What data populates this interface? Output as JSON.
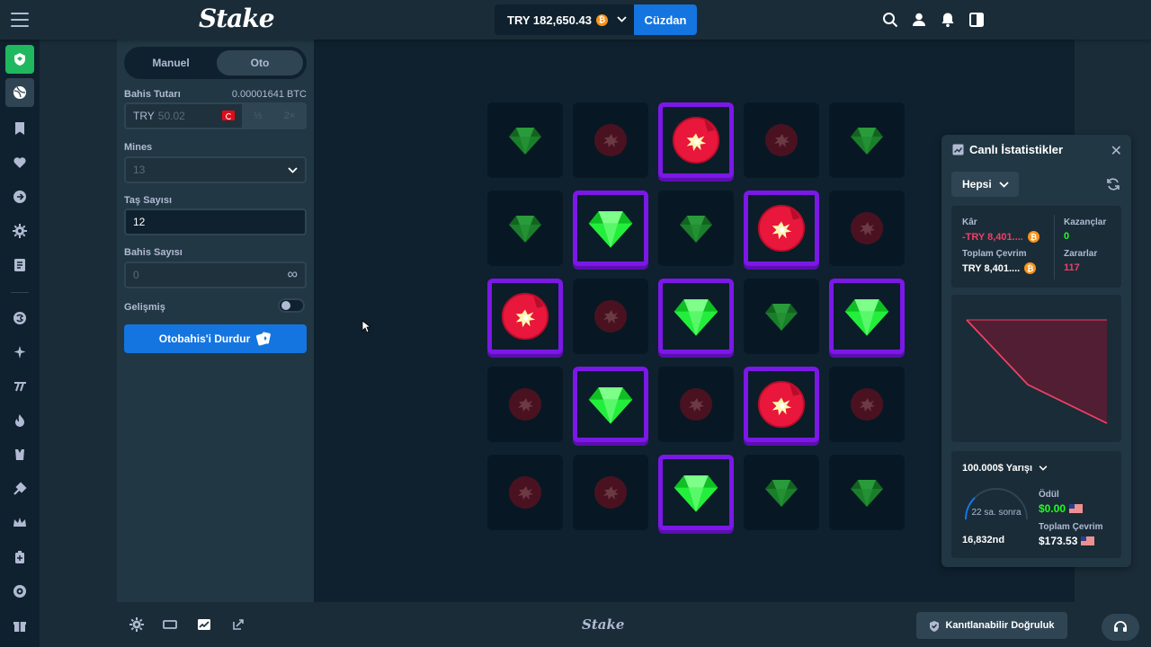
{
  "topbar": {
    "logo": "Stake",
    "balance": "TRY 182,650.43",
    "coin_symbol": "₿",
    "wallet_label": "Cüzdan"
  },
  "panel": {
    "tab_manual": "Manuel",
    "tab_auto": "Oto",
    "bet_amount_label": "Bahis Tutarı",
    "bet_amount_btc": "0.00001641 BTC",
    "bet_currency": "TRY",
    "bet_value": "50.02",
    "half_label": "½",
    "double_label": "2×",
    "mines_label": "Mines",
    "mines_value": "13",
    "gems_label": "Taş Sayısı",
    "gems_value": "12",
    "bets_label": "Bahis Sayısı",
    "bets_value": "0",
    "infinity": "∞",
    "advanced_label": "Gelişmiş",
    "stop_label": "Otobahis'i Durdur"
  },
  "board": {
    "rows": [
      [
        {
          "t": "gem",
          "p": false
        },
        {
          "t": "mine",
          "p": false
        },
        {
          "t": "mine",
          "p": true
        },
        {
          "t": "mine",
          "p": false
        },
        {
          "t": "gem",
          "p": false
        }
      ],
      [
        {
          "t": "gem",
          "p": false
        },
        {
          "t": "gem",
          "p": true
        },
        {
          "t": "gem",
          "p": false
        },
        {
          "t": "mine",
          "p": true
        },
        {
          "t": "mine",
          "p": false
        }
      ],
      [
        {
          "t": "mine",
          "p": true
        },
        {
          "t": "mine",
          "p": false
        },
        {
          "t": "gem",
          "p": true
        },
        {
          "t": "gem",
          "p": false
        },
        {
          "t": "gem",
          "p": true
        }
      ],
      [
        {
          "t": "mine",
          "p": false
        },
        {
          "t": "gem",
          "p": true
        },
        {
          "t": "mine",
          "p": false
        },
        {
          "t": "mine",
          "p": true
        },
        {
          "t": "mine",
          "p": false
        }
      ],
      [
        {
          "t": "mine",
          "p": false
        },
        {
          "t": "mine",
          "p": false
        },
        {
          "t": "gem",
          "p": true
        },
        {
          "t": "gem",
          "p": false
        },
        {
          "t": "gem",
          "p": false
        }
      ]
    ]
  },
  "bottombar": {
    "logo": "Stake",
    "fairness_label": "Kanıtlanabilir Doğruluk"
  },
  "stats": {
    "title": "Canlı İstatistikler",
    "filter": "Hepsi",
    "profit_label": "Kâr",
    "profit_value": "-TRY 8,401....",
    "wins_label": "Kazançlar",
    "wins_value": "0",
    "wagered_label": "Toplam Çevrim",
    "wagered_value": "TRY 8,401....",
    "losses_label": "Zararlar",
    "losses_value": "117",
    "race_label": "100.000$ Yarışı",
    "race_time": "22 sa. sonra",
    "rank": "16,832nd",
    "prize_label": "Ödül",
    "prize_value": "$0.00",
    "race_wagered_label": "Toplam Çevrim",
    "race_wagered_value": "$173.53",
    "colors": {
      "loss": "#ed4163",
      "win": "#1fff20",
      "accent": "#1475e1",
      "picked": "#7b18e7"
    }
  }
}
